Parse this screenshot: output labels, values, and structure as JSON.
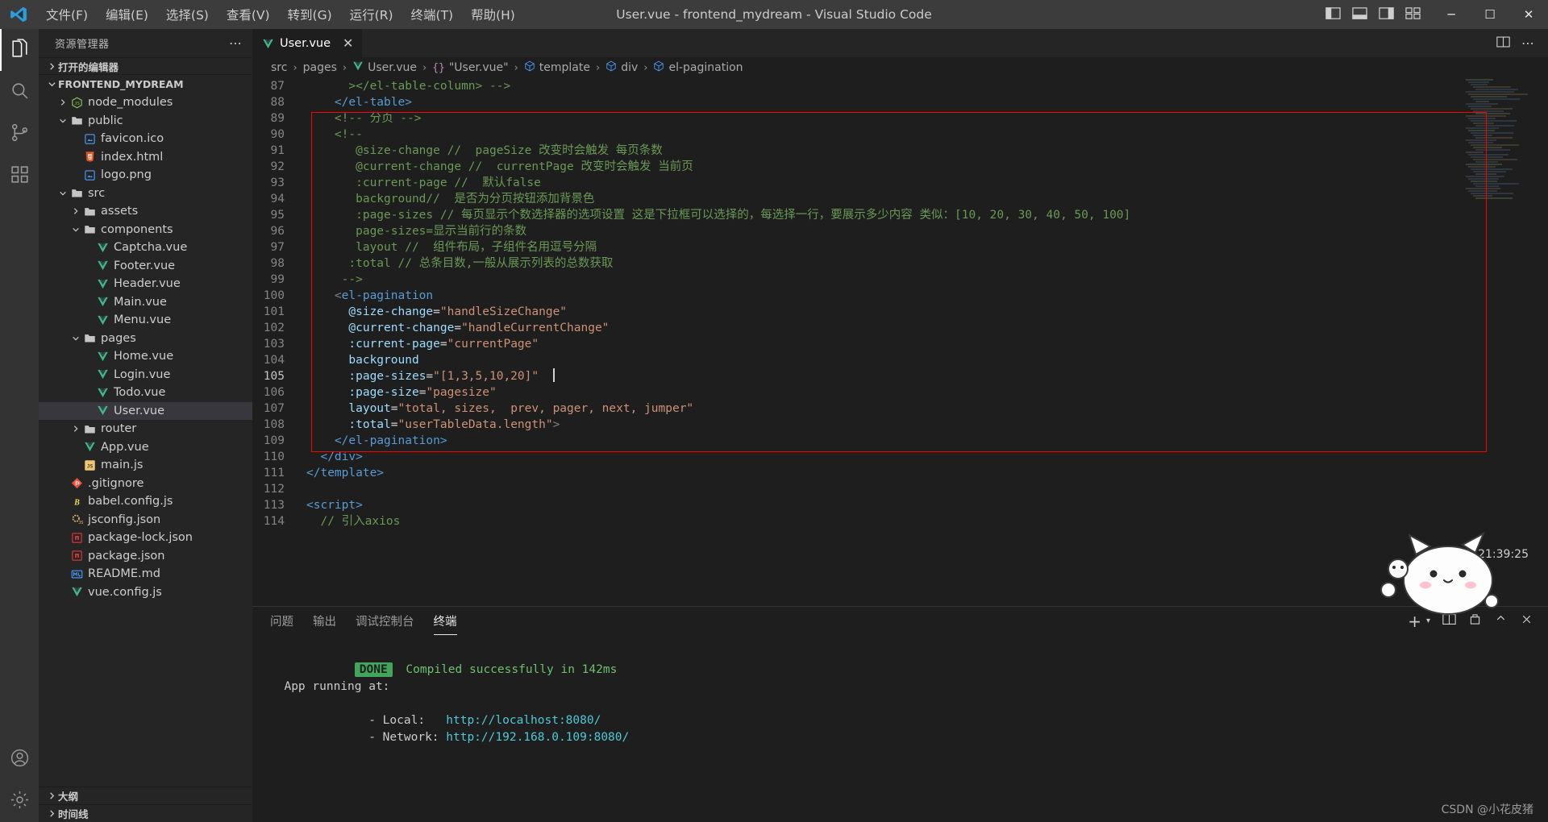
{
  "titlebar": {
    "logo_icon": "vscode-logo-icon",
    "window_title": "User.vue - frontend_mydream - Visual Studio Code",
    "menus": [
      {
        "label": "文件(F)"
      },
      {
        "label": "编辑(E)"
      },
      {
        "label": "选择(S)"
      },
      {
        "label": "查看(V)"
      },
      {
        "label": "转到(G)"
      },
      {
        "label": "运行(R)"
      },
      {
        "label": "终端(T)"
      },
      {
        "label": "帮助(H)"
      }
    ],
    "layout_icons": [
      "toggle-primary-sidebar-icon",
      "toggle-panel-icon",
      "toggle-secondary-sidebar-icon",
      "customize-layout-icon"
    ],
    "window_controls": {
      "minimize": "─",
      "maximize": "☐",
      "close": "✕"
    }
  },
  "activitybar": {
    "items": [
      {
        "name": "explorer",
        "icon": "files-icon",
        "active": true
      },
      {
        "name": "search",
        "icon": "search-icon",
        "active": false
      },
      {
        "name": "source-control",
        "icon": "source-control-icon",
        "active": false
      },
      {
        "name": "extensions",
        "icon": "extensions-icon",
        "active": false
      }
    ],
    "bottom_items": [
      {
        "name": "accounts",
        "icon": "account-icon"
      },
      {
        "name": "settings",
        "icon": "gear-icon"
      }
    ]
  },
  "sidebar": {
    "header_title": "资源管理器",
    "header_more": "⋯",
    "open_editors_label": "打开的编辑器",
    "project_label": "FRONTEND_MYDREAM",
    "outline_label": "大纲",
    "timeline_label": "时间线",
    "tree": [
      {
        "label": "node_modules",
        "icon": "nodejs-folder-icon",
        "indent": 1,
        "twisty": "collapsed",
        "selected": false
      },
      {
        "label": "public",
        "icon": "folder-open-icon",
        "indent": 1,
        "twisty": "expanded",
        "selected": false
      },
      {
        "label": "favicon.ico",
        "icon": "image-icon",
        "indent": 2,
        "twisty": "none",
        "selected": false
      },
      {
        "label": "index.html",
        "icon": "html-icon",
        "indent": 2,
        "twisty": "none",
        "selected": false
      },
      {
        "label": "logo.png",
        "icon": "image-icon",
        "indent": 2,
        "twisty": "none",
        "selected": false
      },
      {
        "label": "src",
        "icon": "folder-open-icon",
        "indent": 1,
        "twisty": "expanded",
        "selected": false
      },
      {
        "label": "assets",
        "icon": "folder-icon",
        "indent": 2,
        "twisty": "collapsed",
        "selected": false
      },
      {
        "label": "components",
        "icon": "folder-open-icon",
        "indent": 2,
        "twisty": "expanded",
        "selected": false
      },
      {
        "label": "Captcha.vue",
        "icon": "vue-icon",
        "indent": 3,
        "twisty": "none",
        "selected": false
      },
      {
        "label": "Footer.vue",
        "icon": "vue-icon",
        "indent": 3,
        "twisty": "none",
        "selected": false
      },
      {
        "label": "Header.vue",
        "icon": "vue-icon",
        "indent": 3,
        "twisty": "none",
        "selected": false
      },
      {
        "label": "Main.vue",
        "icon": "vue-icon",
        "indent": 3,
        "twisty": "none",
        "selected": false
      },
      {
        "label": "Menu.vue",
        "icon": "vue-icon",
        "indent": 3,
        "twisty": "none",
        "selected": false
      },
      {
        "label": "pages",
        "icon": "folder-open-icon",
        "indent": 2,
        "twisty": "expanded",
        "selected": false
      },
      {
        "label": "Home.vue",
        "icon": "vue-icon",
        "indent": 3,
        "twisty": "none",
        "selected": false
      },
      {
        "label": "Login.vue",
        "icon": "vue-icon",
        "indent": 3,
        "twisty": "none",
        "selected": false
      },
      {
        "label": "Todo.vue",
        "icon": "vue-icon",
        "indent": 3,
        "twisty": "none",
        "selected": false
      },
      {
        "label": "User.vue",
        "icon": "vue-icon",
        "indent": 3,
        "twisty": "none",
        "selected": true
      },
      {
        "label": "router",
        "icon": "folder-icon",
        "indent": 2,
        "twisty": "collapsed",
        "selected": false
      },
      {
        "label": "App.vue",
        "icon": "vue-icon",
        "indent": 2,
        "twisty": "none",
        "selected": false
      },
      {
        "label": "main.js",
        "icon": "js-icon",
        "indent": 2,
        "twisty": "none",
        "selected": false
      },
      {
        "label": ".gitignore",
        "icon": "git-icon",
        "indent": 1,
        "twisty": "none",
        "selected": false
      },
      {
        "label": "babel.config.js",
        "icon": "babel-icon",
        "indent": 1,
        "twisty": "none",
        "selected": false
      },
      {
        "label": "jsconfig.json",
        "icon": "jsconfig-icon",
        "indent": 1,
        "twisty": "none",
        "selected": false
      },
      {
        "label": "package-lock.json",
        "icon": "npm-icon",
        "indent": 1,
        "twisty": "none",
        "selected": false
      },
      {
        "label": "package.json",
        "icon": "npm-icon",
        "indent": 1,
        "twisty": "none",
        "selected": false
      },
      {
        "label": "README.md",
        "icon": "markdown-icon",
        "indent": 1,
        "twisty": "none",
        "selected": false
      },
      {
        "label": "vue.config.js",
        "icon": "vue-icon",
        "indent": 1,
        "twisty": "none",
        "selected": false
      }
    ]
  },
  "editor": {
    "tab": {
      "label": "User.vue",
      "icon": "vue-icon",
      "close": "✕"
    },
    "tab_actions": [
      "split-editor-icon",
      "more-actions-icon"
    ],
    "breadcrumb": [
      {
        "label": "src",
        "icon": null
      },
      {
        "label": "pages",
        "icon": null
      },
      {
        "label": "User.vue",
        "icon": "vue-icon"
      },
      {
        "label": "\"User.vue\"",
        "icon": "braces-icon"
      },
      {
        "label": "template",
        "icon": "symbol-field-icon"
      },
      {
        "label": "div",
        "icon": "symbol-field-icon"
      },
      {
        "label": "el-pagination",
        "icon": "symbol-field-icon"
      }
    ],
    "first_line_number": 87,
    "cursor_line": 105,
    "lines": [
      {
        "n": 87,
        "segments": [
          {
            "t": "      ",
            "c": "plain"
          },
          {
            "t": "></el-table-column> -->",
            "c": "com"
          }
        ]
      },
      {
        "n": 88,
        "segments": [
          {
            "t": "    ",
            "c": "plain"
          },
          {
            "t": "</el-table>",
            "c": "tag"
          }
        ]
      },
      {
        "n": 89,
        "segments": [
          {
            "t": "    ",
            "c": "plain"
          },
          {
            "t": "<!-- 分页 -->",
            "c": "com"
          }
        ]
      },
      {
        "n": 90,
        "segments": [
          {
            "t": "    ",
            "c": "plain"
          },
          {
            "t": "<!--",
            "c": "com"
          }
        ]
      },
      {
        "n": 91,
        "segments": [
          {
            "t": "       ",
            "c": "plain"
          },
          {
            "t": "@size-change //  pageSize 改变时会触发 每页条数",
            "c": "com"
          }
        ]
      },
      {
        "n": 92,
        "segments": [
          {
            "t": "       ",
            "c": "plain"
          },
          {
            "t": "@current-change //  currentPage 改变时会触发 当前页",
            "c": "com"
          }
        ]
      },
      {
        "n": 93,
        "segments": [
          {
            "t": "       ",
            "c": "plain"
          },
          {
            "t": ":current-page //  默认false",
            "c": "com"
          }
        ]
      },
      {
        "n": 94,
        "segments": [
          {
            "t": "       ",
            "c": "plain"
          },
          {
            "t": "background//  是否为分页按钮添加背景色",
            "c": "com"
          }
        ]
      },
      {
        "n": 95,
        "segments": [
          {
            "t": "       ",
            "c": "plain"
          },
          {
            "t": ":page-sizes // 每页显示个数选择器的选项设置 这是下拉框可以选择的，每选择一行，要展示多少内容 类似：[10, 20, 30, 40, 50, 100]",
            "c": "com"
          }
        ]
      },
      {
        "n": 96,
        "segments": [
          {
            "t": "       ",
            "c": "plain"
          },
          {
            "t": "page-sizes=显示当前行的条数",
            "c": "com"
          }
        ]
      },
      {
        "n": 97,
        "segments": [
          {
            "t": "       ",
            "c": "plain"
          },
          {
            "t": "layout //  组件布局，子组件名用逗号分隔",
            "c": "com"
          }
        ]
      },
      {
        "n": 98,
        "segments": [
          {
            "t": "      ",
            "c": "plain"
          },
          {
            "t": ":total // 总条目数,一般从展示列表的总数获取",
            "c": "com"
          }
        ]
      },
      {
        "n": 99,
        "segments": [
          {
            "t": "     ",
            "c": "plain"
          },
          {
            "t": "-->",
            "c": "com"
          }
        ]
      },
      {
        "n": 100,
        "segments": [
          {
            "t": "    ",
            "c": "plain"
          },
          {
            "t": "<",
            "c": "punct"
          },
          {
            "t": "el-pagination",
            "c": "tag"
          }
        ]
      },
      {
        "n": 101,
        "segments": [
          {
            "t": "      ",
            "c": "plain"
          },
          {
            "t": "@size-change",
            "c": "attr"
          },
          {
            "t": "=",
            "c": "plain"
          },
          {
            "t": "\"handleSizeChange\"",
            "c": "str"
          }
        ]
      },
      {
        "n": 102,
        "segments": [
          {
            "t": "      ",
            "c": "plain"
          },
          {
            "t": "@current-change",
            "c": "attr"
          },
          {
            "t": "=",
            "c": "plain"
          },
          {
            "t": "\"handleCurrentChange\"",
            "c": "str"
          }
        ]
      },
      {
        "n": 103,
        "segments": [
          {
            "t": "      ",
            "c": "plain"
          },
          {
            "t": ":current-page",
            "c": "attr"
          },
          {
            "t": "=",
            "c": "plain"
          },
          {
            "t": "\"currentPage\"",
            "c": "str"
          }
        ]
      },
      {
        "n": 104,
        "segments": [
          {
            "t": "      ",
            "c": "plain"
          },
          {
            "t": "background",
            "c": "attr"
          }
        ]
      },
      {
        "n": 105,
        "segments": [
          {
            "t": "      ",
            "c": "plain"
          },
          {
            "t": ":page-sizes",
            "c": "attr"
          },
          {
            "t": "=",
            "c": "plain"
          },
          {
            "t": "\"[1,3,5,10,20]\"",
            "c": "str"
          }
        ],
        "cursor": true
      },
      {
        "n": 106,
        "segments": [
          {
            "t": "      ",
            "c": "plain"
          },
          {
            "t": ":page-size",
            "c": "attr"
          },
          {
            "t": "=",
            "c": "plain"
          },
          {
            "t": "\"pagesize\"",
            "c": "str"
          }
        ]
      },
      {
        "n": 107,
        "segments": [
          {
            "t": "      ",
            "c": "plain"
          },
          {
            "t": "layout",
            "c": "attr"
          },
          {
            "t": "=",
            "c": "plain"
          },
          {
            "t": "\"total, sizes,  prev, pager, next, jumper\"",
            "c": "str"
          }
        ]
      },
      {
        "n": 108,
        "segments": [
          {
            "t": "      ",
            "c": "plain"
          },
          {
            "t": ":total",
            "c": "attr"
          },
          {
            "t": "=",
            "c": "plain"
          },
          {
            "t": "\"userTableData.length\"",
            "c": "str"
          },
          {
            "t": ">",
            "c": "punct"
          }
        ]
      },
      {
        "n": 109,
        "segments": [
          {
            "t": "    ",
            "c": "plain"
          },
          {
            "t": "</el-pagination>",
            "c": "tag"
          }
        ]
      },
      {
        "n": 110,
        "segments": [
          {
            "t": "  ",
            "c": "plain"
          },
          {
            "t": "</div>",
            "c": "tag"
          }
        ]
      },
      {
        "n": 111,
        "segments": [
          {
            "t": "",
            "c": "plain"
          },
          {
            "t": "</template>",
            "c": "tag"
          }
        ]
      },
      {
        "n": 112,
        "segments": [
          {
            "t": "",
            "c": "plain"
          }
        ]
      },
      {
        "n": 113,
        "segments": [
          {
            "t": "",
            "c": "plain"
          },
          {
            "t": "<script>",
            "c": "tag"
          }
        ]
      },
      {
        "n": 114,
        "segments": [
          {
            "t": "  ",
            "c": "plain"
          },
          {
            "t": "// 引入axios",
            "c": "com"
          }
        ]
      }
    ],
    "highlight_box_color": "#ff0000"
  },
  "panel": {
    "tabs": [
      {
        "label": "问题",
        "active": false
      },
      {
        "label": "输出",
        "active": false
      },
      {
        "label": "调试控制台",
        "active": false
      },
      {
        "label": "终端",
        "active": true
      }
    ],
    "actions": [
      "add-terminal-icon",
      "terminal-dropdown-icon",
      "split-terminal-icon",
      "kill-terminal-icon",
      "maximize-panel-icon",
      "close-panel-icon"
    ],
    "terminal_lines": [
      {
        "badge": "DONE",
        "text": " Compiled successfully in 142ms",
        "color": "green"
      },
      {
        "text": ""
      },
      {
        "text": "  App running at:"
      },
      {
        "label": "  - Local:   ",
        "link": "http://localhost:8080/"
      },
      {
        "label": "  - Network: ",
        "link": "http://192.168.0.109:8080/"
      }
    ],
    "clock": "21:39:25"
  },
  "watermark": "CSDN @小花皮猪"
}
